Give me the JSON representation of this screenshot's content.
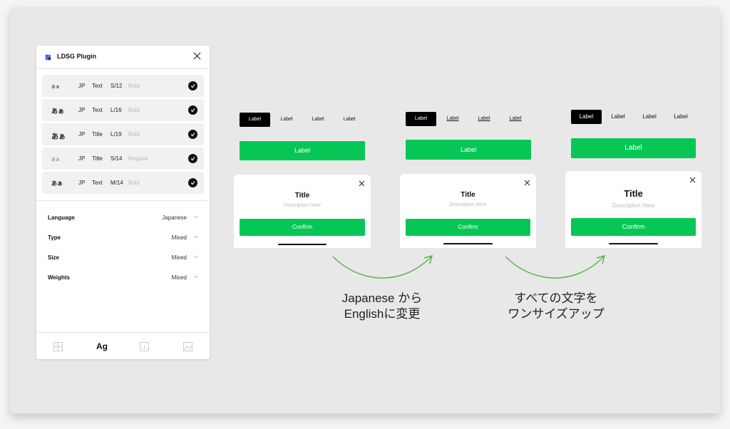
{
  "plugin": {
    "title": "LDSG Plugin",
    "styles": [
      {
        "sample": "あぁ",
        "lang": "JP",
        "type": "Text",
        "size": "S/12",
        "weight": "Bold"
      },
      {
        "sample": "あぁ",
        "lang": "JP",
        "type": "Text",
        "size": "L/16",
        "weight": "Bold"
      },
      {
        "sample": "あぁ",
        "lang": "JP",
        "type": "Title",
        "size": "L/19",
        "weight": "Bold"
      },
      {
        "sample": "あぁ",
        "lang": "JP",
        "type": "Title",
        "size": "S/14",
        "weight": "Regular"
      },
      {
        "sample": "あぁ",
        "lang": "JP",
        "type": "Text",
        "size": "M/14",
        "weight": "Bold"
      }
    ],
    "properties": [
      {
        "label": "Language",
        "value": "Japanese"
      },
      {
        "label": "Type",
        "value": "Mixed"
      },
      {
        "label": "Size",
        "value": "Mixed"
      },
      {
        "label": "Weights",
        "value": "Mixed"
      }
    ],
    "footer_tab_active": "Ag"
  },
  "previews": [
    {
      "tabs": [
        "Label",
        "Label",
        "Label",
        "Label"
      ],
      "button": "Label",
      "card_title": "Title",
      "card_desc": "Description Here",
      "confirm": "Confirm"
    },
    {
      "tabs": [
        "Label",
        "Label",
        "Label",
        "Label"
      ],
      "button": "Label",
      "card_title": "Title",
      "card_desc": "Description Here",
      "confirm": "Confirm"
    },
    {
      "tabs": [
        "Label",
        "Label",
        "Label",
        "Label"
      ],
      "button": "Label",
      "card_title": "Title",
      "card_desc": "Description Here",
      "confirm": "Confirm"
    }
  ],
  "captions": {
    "first_line1": "Japanese から",
    "first_line2": "Englishに変更",
    "second_line1": "すべての文字を",
    "second_line2": "ワンサイズアップ"
  },
  "colors": {
    "accent_green": "#06c755",
    "arrow_green": "#59b84a"
  }
}
